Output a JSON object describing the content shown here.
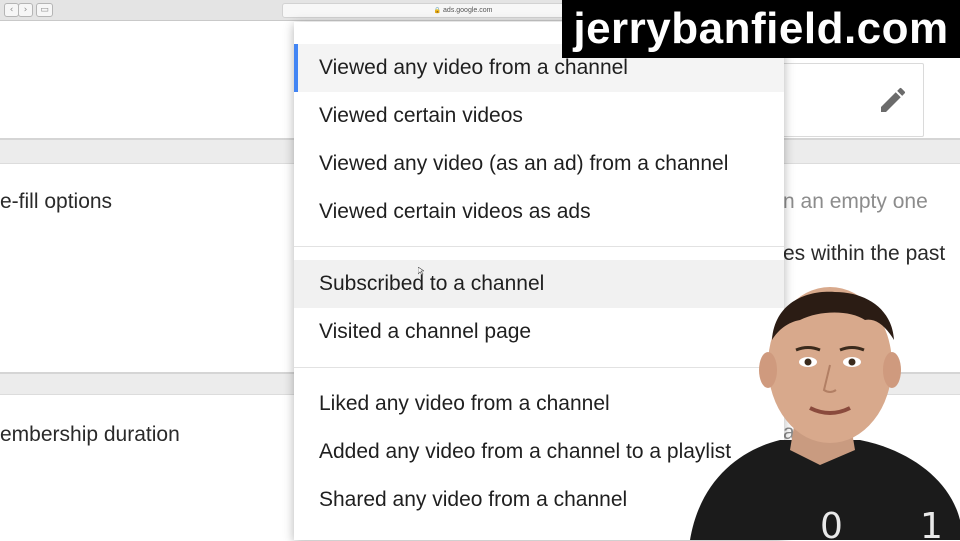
{
  "browser": {
    "url": "ads.google.com",
    "back_glyph": "‹",
    "forward_glyph": "›",
    "sidebar_glyph": "▭"
  },
  "background": {
    "left_labels": [
      "e-fill options",
      "embership duration"
    ],
    "right_texts": [
      "n an empty one",
      "es within the past",
      "auc"
    ]
  },
  "menu": {
    "groups": [
      {
        "items": [
          {
            "label": "Viewed any video from a channel",
            "selected": true
          },
          {
            "label": "Viewed certain videos"
          },
          {
            "label": "Viewed any video (as an ad) from a channel"
          },
          {
            "label": "Viewed certain videos as ads"
          }
        ]
      },
      {
        "items": [
          {
            "label": "Subscribed to a channel",
            "hovered": true
          },
          {
            "label": "Visited a channel page"
          }
        ]
      },
      {
        "items": [
          {
            "label": "Liked any video from a channel"
          },
          {
            "label": "Added any video from a channel to a playlist"
          },
          {
            "label": "Shared any video from a channel"
          }
        ]
      }
    ]
  },
  "icons": {
    "edit": "pencil-icon"
  },
  "overlay": {
    "brand_text": "jerrybanfield.com"
  },
  "colors": {
    "accent_blue": "#4285f4",
    "menu_hover": "#f1f1f1",
    "brand_bg": "#000000"
  }
}
